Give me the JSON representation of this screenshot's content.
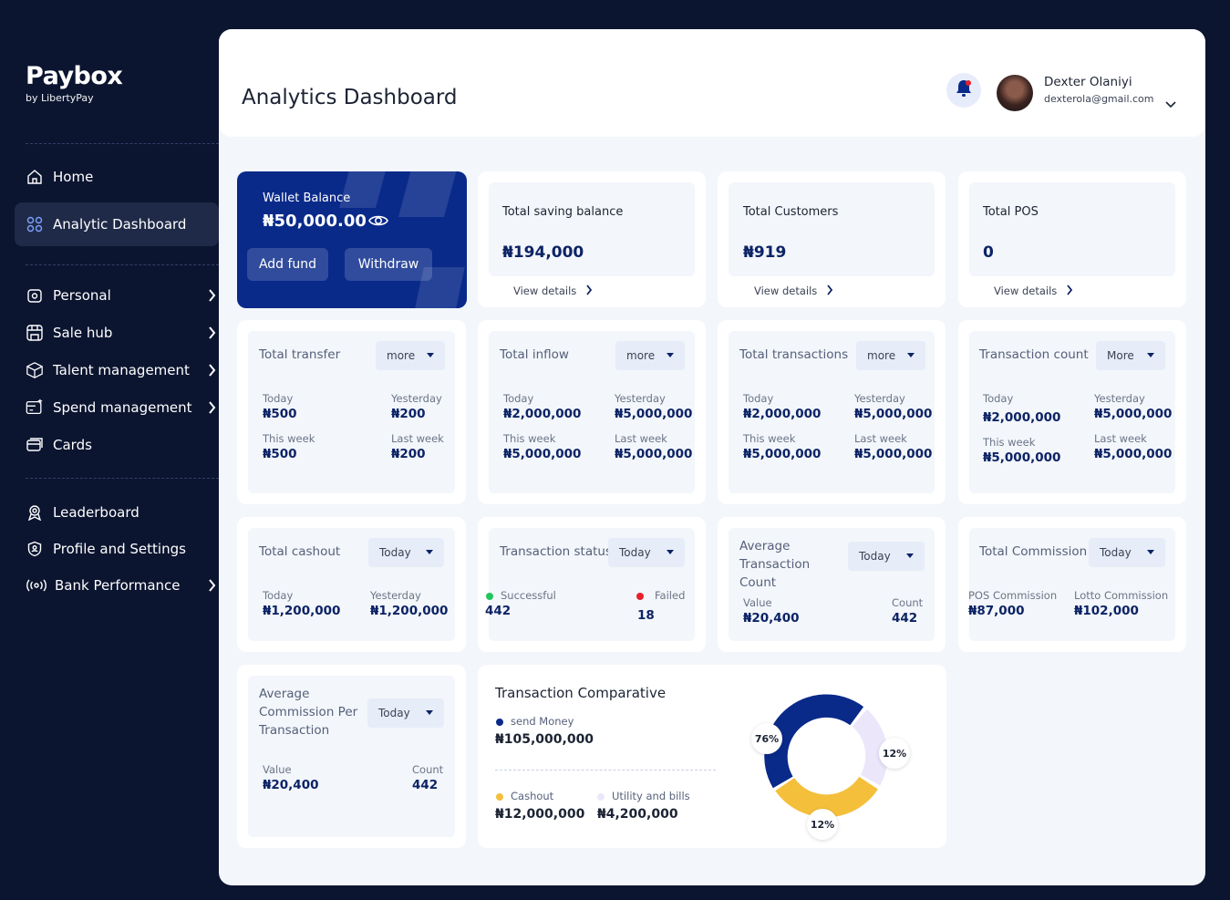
{
  "brand": {
    "name": "Paybox",
    "sub": "by LibertyPay"
  },
  "nav": {
    "home": "Home",
    "analytic": "Analytic Dashboard",
    "personal": "Personal",
    "sale_hub": "Sale hub",
    "talent": "Talent management",
    "spend": "Spend management",
    "cards": "Cards",
    "leaderboard": "Leaderboard",
    "profile": "Profile and Settings",
    "bank": "Bank Performance"
  },
  "header": {
    "title": "Analytics Dashboard",
    "user_name": "Dexter Olaniyi",
    "user_email": "dexterola@gmail.com"
  },
  "wallet": {
    "label": "Wallet Balance",
    "amount": "₦50,000.00",
    "add_fund": "Add fund",
    "withdraw": "Withdraw"
  },
  "stats": [
    {
      "title": "Total saving balance",
      "value": "₦194,000",
      "link": "View details"
    },
    {
      "title": "Total Customers",
      "value": "₦919",
      "link": "View details"
    },
    {
      "title": "Total POS",
      "value": "0",
      "link": "View details"
    }
  ],
  "row2": [
    {
      "title": "Total transfer",
      "dropdown": "more",
      "today_label": "Today",
      "today": "₦500",
      "yesterday_label": "Yesterday",
      "yesterday": "₦200",
      "week_label": "This week",
      "week": "₦500",
      "lastweek_label": "Last week",
      "lastweek": "₦200"
    },
    {
      "title": "Total inflow",
      "dropdown": "more",
      "today_label": "Today",
      "today": "₦2,000,000",
      "yesterday_label": "Yesterday",
      "yesterday": "₦5,000,000",
      "week_label": "This week",
      "week": "₦5,000,000",
      "lastweek_label": "Last week",
      "lastweek": "₦5,000,000"
    },
    {
      "title": "Total transactions",
      "dropdown": "more",
      "today_label": "Today",
      "today": "₦2,000,000",
      "yesterday_label": "Yesterday",
      "yesterday": "₦5,000,000",
      "week_label": "This week",
      "week": "₦5,000,000",
      "lastweek_label": "Last week",
      "lastweek": "₦5,000,000"
    },
    {
      "title": "Transaction count",
      "dropdown": "More",
      "today_label": "Today",
      "today": "₦2,000,000",
      "yesterday_label": "Yesterday",
      "yesterday": "₦5,000,000",
      "week_label": "This week",
      "week": "₦5,000,000",
      "lastweek_label": "Last week",
      "lastweek": "₦5,000,000"
    }
  ],
  "cashout": {
    "title": "Total cashout",
    "dropdown": "Today",
    "today_label": "Today",
    "today": "₦1,200,000",
    "yesterday_label": "Yesterday",
    "yesterday": "₦1,200,000"
  },
  "status": {
    "title": "Transaction status",
    "dropdown": "Today",
    "success_label": "Successful",
    "success": "442",
    "failed_label": "Failed",
    "failed": "18"
  },
  "avg_count": {
    "title": "Average Transaction Count",
    "dropdown": "Today",
    "value_label": "Value",
    "value": "₦20,400",
    "count_label": "Count",
    "count": "442"
  },
  "commission": {
    "title": "Total Commission",
    "dropdown": "Today",
    "pos_label": "POS Commission",
    "pos": "₦87,000",
    "lotto_label": "Lotto Commission",
    "lotto": "₦102,000"
  },
  "avg_commission": {
    "title": "Average Commission Per Transaction",
    "dropdown": "Today",
    "value_label": "Value",
    "value": "₦20,400",
    "count_label": "Count",
    "count": "442"
  },
  "comparative": {
    "title": "Transaction Comparative",
    "send_label": "send Money",
    "send": "₦105,000,000",
    "cashout_label": "Cashout",
    "cashout": "₦12,000,000",
    "utility_label": "Utility and bills",
    "utility": "₦4,200,000",
    "pct_send": "76%",
    "pct_utility": "12%",
    "pct_cashout": "12%"
  },
  "colors": {
    "navy": "#0b1530",
    "brand_blue": "#0a2a8a",
    "gold": "#f4bf3a",
    "lavender": "#ece6fb",
    "success": "#22c55e",
    "danger": "#e5202b"
  }
}
